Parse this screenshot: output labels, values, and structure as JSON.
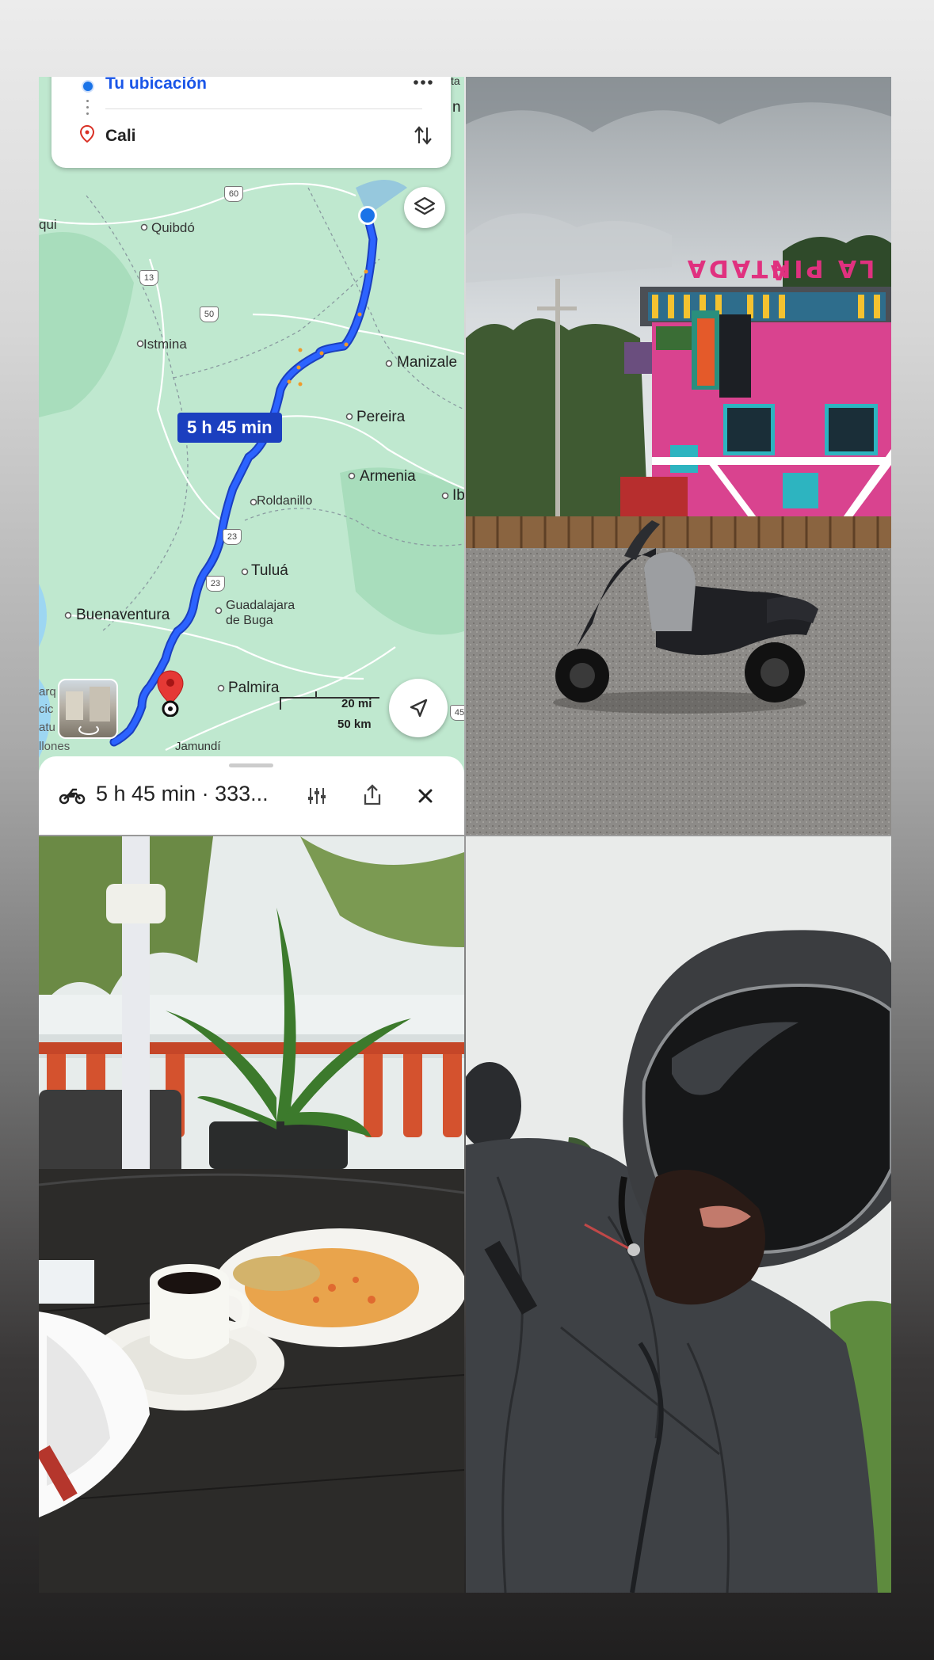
{
  "map": {
    "origin_label": "Tu ubicación",
    "destination_label": "Cali",
    "route_time_badge": "5 h 45 min",
    "scale_miles": "20 mi",
    "scale_km": "50 km",
    "cities": {
      "quibdo": "Quibdó",
      "istmina": "Istmina",
      "manizales": "Manizale",
      "pereira": "Pereira",
      "armenia": "Armenia",
      "roldanillo": "Roldanillo",
      "tulua": "Tuluá",
      "buga_1": "Guadalajara",
      "buga_2": "de Buga",
      "buenaventura": "Buenaventura",
      "palmira": "Palmira",
      "jamundi": "Jamundí",
      "edge_qui": "qui",
      "edge_ib": "Ib",
      "edge_ta": "ta",
      "edge_n": "n",
      "edge_arq": "arq",
      "edge_cic": "cic",
      "edge_atu": "atu",
      "edge_llones": "llones",
      "edge_45": "45"
    },
    "shields": {
      "s60": "60",
      "s13": "13",
      "s50": "50",
      "s23a": "23",
      "s23b": "23"
    },
    "summary": "5 h 45 min · 333...",
    "accent_color": "#1a56e8",
    "route_color": "#1a4fe0"
  },
  "moto_photo": {
    "sign_text": "LA PINTADA"
  },
  "icons": [
    "more-icon",
    "swap-icon",
    "layers-icon",
    "navigate-icon",
    "motorcycle-icon",
    "options-icon",
    "share-icon",
    "close-icon",
    "location-pin-icon",
    "origin-dot-icon"
  ]
}
